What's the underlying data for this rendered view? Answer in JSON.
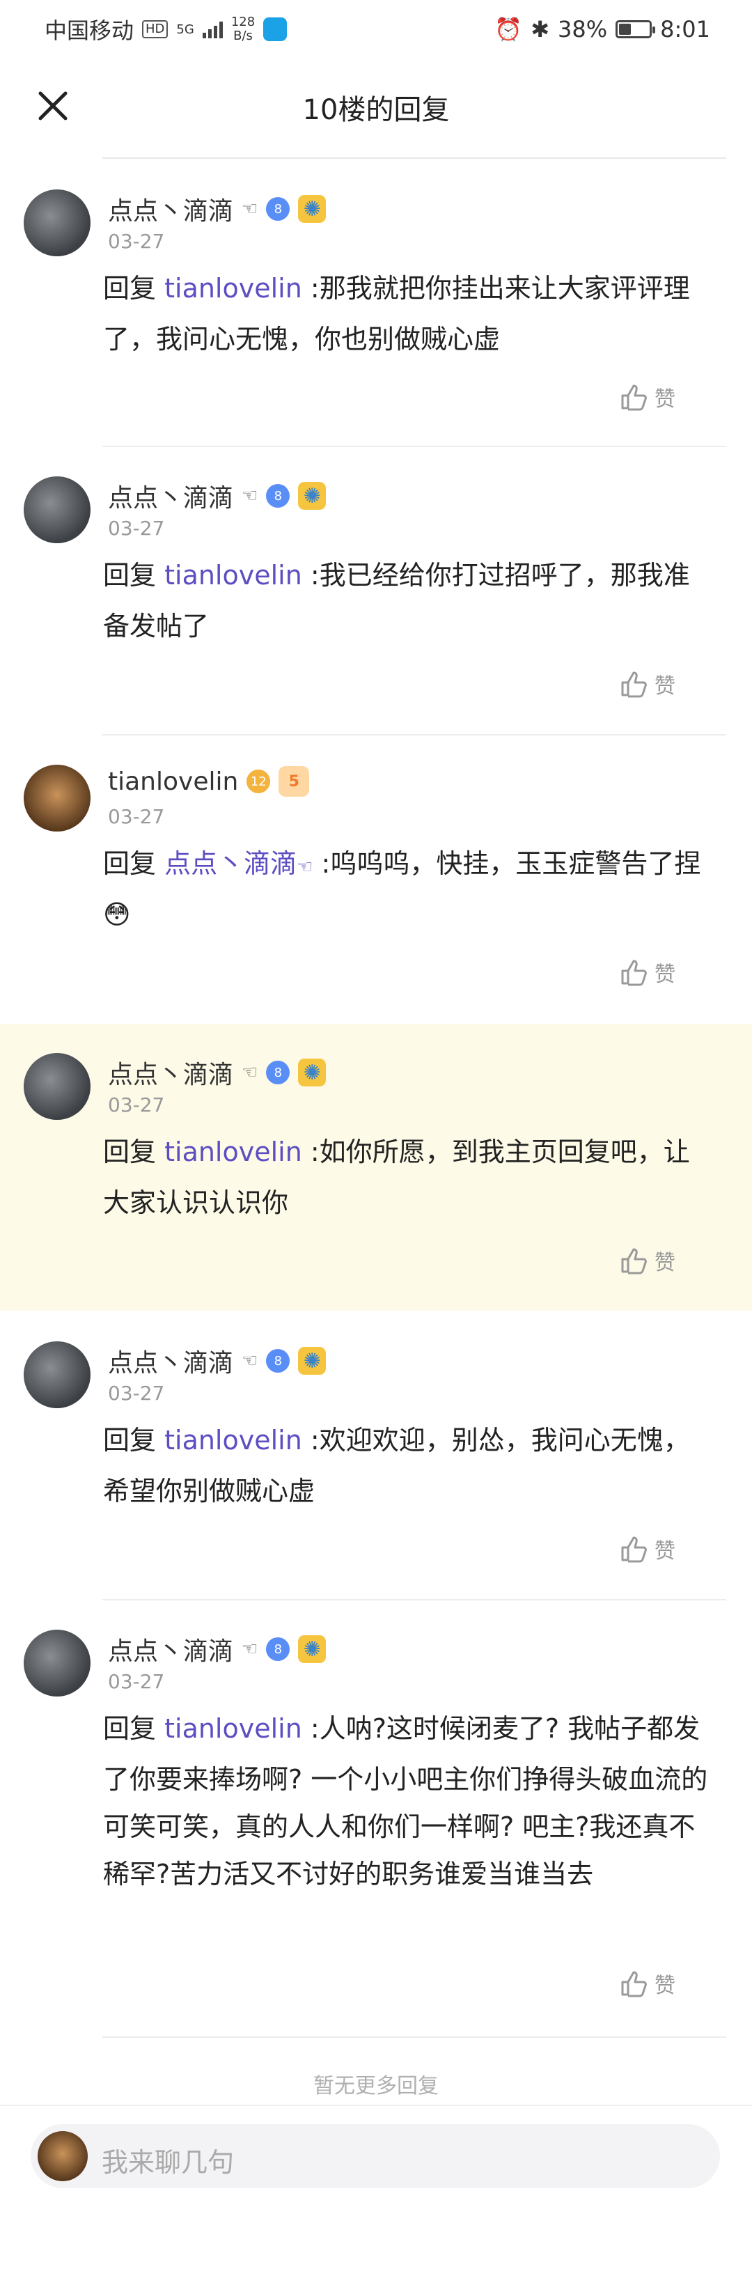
{
  "status_bar": {
    "carrier": "中国移动",
    "hd": "HD",
    "network": "5G",
    "speed_value": "128",
    "speed_unit": "B/s",
    "battery": "38%",
    "time": "8:01"
  },
  "header": {
    "title": "10楼的回复"
  },
  "replies": [
    {
      "username": "点点丶滴滴",
      "user_hand": "☜",
      "level": "8",
      "date": "03-27",
      "reply_prefix": "回复",
      "mention": "tianlovelin",
      "mention_hand": "",
      "text": " :那我就把你挂出来让大家评评理了，我问心无愧，你也别做贼心虚",
      "emoji": "",
      "like_label": "赞"
    },
    {
      "username": "点点丶滴滴",
      "user_hand": "☜",
      "level": "8",
      "date": "03-27",
      "reply_prefix": "回复",
      "mention": "tianlovelin",
      "mention_hand": "",
      "text": " :我已经给你打过招呼了，那我准备发帖了",
      "emoji": "",
      "like_label": "赞"
    },
    {
      "username": "tianlovelin",
      "user_hand": "",
      "level": "12",
      "badge2": "5",
      "date": "03-27",
      "reply_prefix": "回复",
      "mention": "点点丶滴滴",
      "mention_hand": "☜",
      "text": " :呜呜呜，快挂，玉玉症警告了捏",
      "emoji": "😳",
      "like_label": "赞"
    },
    {
      "username": "点点丶滴滴",
      "user_hand": "☜",
      "level": "8",
      "date": "03-27",
      "reply_prefix": "回复",
      "mention": "tianlovelin",
      "mention_hand": "",
      "text": " :如你所愿，到我主页回复吧，让大家认识认识你",
      "emoji": "",
      "like_label": "赞"
    },
    {
      "username": "点点丶滴滴",
      "user_hand": "☜",
      "level": "8",
      "date": "03-27",
      "reply_prefix": "回复",
      "mention": "tianlovelin",
      "mention_hand": "",
      "text": " :欢迎欢迎，别怂，我问心无愧，希望你别做贼心虚",
      "emoji": "",
      "like_label": "赞"
    },
    {
      "username": "点点丶滴滴",
      "user_hand": "☜",
      "level": "8",
      "date": "03-27",
      "reply_prefix": "回复",
      "mention": "tianlovelin",
      "mention_hand": "",
      "text": " :人呐?这时候闭麦了? 我帖子都发了你要来捧场啊? 一个小小吧主你们挣得头破血流的可笑可笑，真的人人和你们一样啊? 吧主?我还真不稀罕?苦力活又不讨好的职务谁爱当谁当去",
      "emoji": "",
      "like_label": "赞"
    }
  ],
  "footer": {
    "no_more": "暂无更多回复"
  },
  "input": {
    "placeholder": "我来聊几句"
  }
}
